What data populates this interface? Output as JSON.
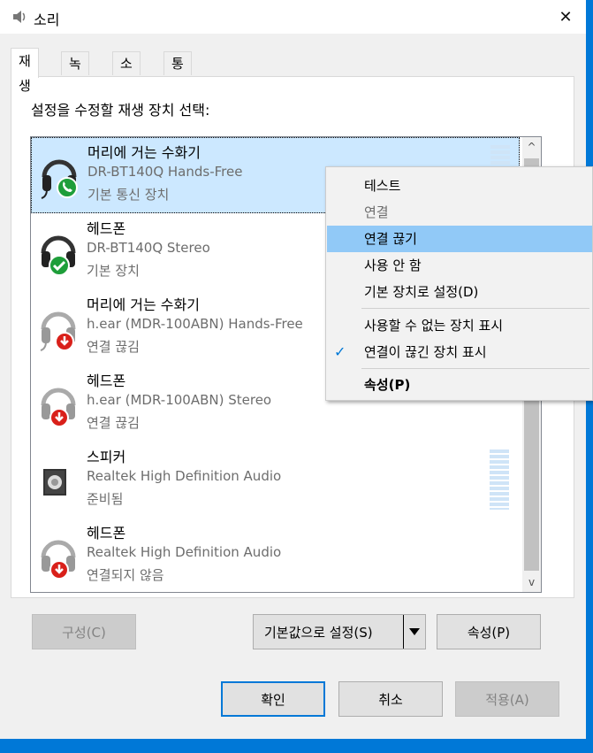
{
  "window": {
    "title": "소리",
    "close_symbol": "✕"
  },
  "tabs": [
    "재생",
    "녹음",
    "소리",
    "통신"
  ],
  "instruction": "설정을 수정할 재생 장치 선택:",
  "devices": [
    {
      "name": "머리에 거는 수화기",
      "desc": "DR-BT140Q Hands-Free",
      "status": "기본 통신 장치"
    },
    {
      "name": "헤드폰",
      "desc": "DR-BT140Q Stereo",
      "status": "기본 장치"
    },
    {
      "name": "머리에 거는 수화기",
      "desc": "h.ear (MDR-100ABN) Hands-Free",
      "status": "연결 끊김"
    },
    {
      "name": "헤드폰",
      "desc": "h.ear (MDR-100ABN) Stereo",
      "status": "연결 끊김"
    },
    {
      "name": "스피커",
      "desc": "Realtek High Definition Audio",
      "status": "준비됨"
    },
    {
      "name": "헤드폰",
      "desc": "Realtek High Definition Audio",
      "status": "연결되지 않음"
    }
  ],
  "scrollbar": {
    "up": "^",
    "down": "v"
  },
  "buttons": {
    "configure": "구성(C)",
    "set_default": "기본값으로 설정(S)",
    "properties": "속성(P)",
    "ok": "확인",
    "cancel": "취소",
    "apply": "적용(A)"
  },
  "context_menu": {
    "test": "테스트",
    "connect": "연결",
    "disconnect": "연결 끊기",
    "disable": "사용 안 함",
    "set_default": "기본 장치로 설정(D)",
    "show_disabled": "사용할 수 없는 장치 표시",
    "show_disconnected": "연결이 끊긴 장치 표시",
    "properties": "속성(P)",
    "check_symbol": "✓"
  },
  "colors": {
    "selection": "#cce8ff",
    "menu_highlight": "#91c9f7",
    "accent": "#0078d7",
    "status_green": "#1e9e3a",
    "status_red": "#d9201a"
  }
}
